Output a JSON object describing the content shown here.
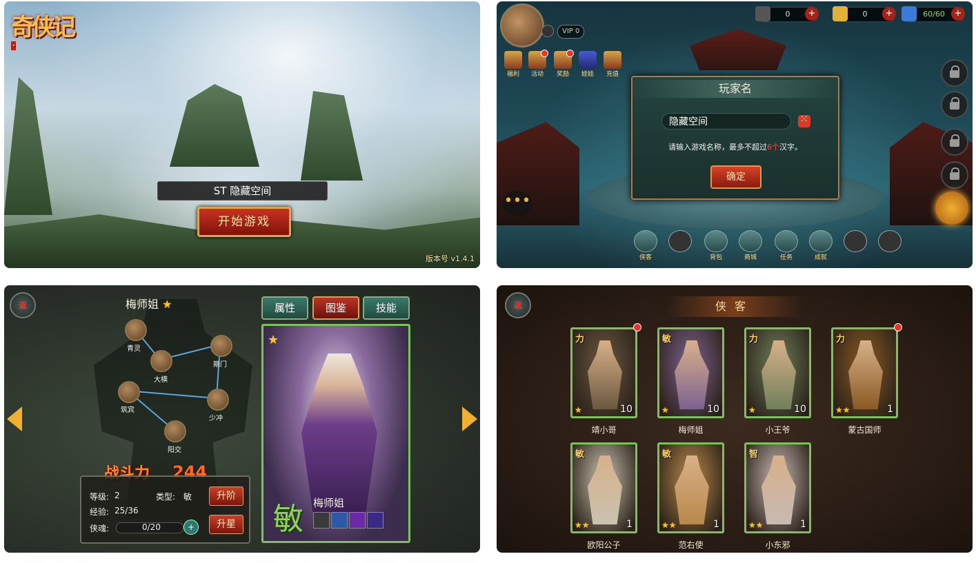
{
  "panel1": {
    "logo_text": "奇侠记",
    "server_label": "ST 隐藏空间",
    "start_button": "开始游戏",
    "version": "版本号 v1.4.1"
  },
  "panel2": {
    "resources": [
      {
        "icon": "coin-icon",
        "value": "0"
      },
      {
        "icon": "gold-ingot-icon",
        "value": "0"
      },
      {
        "icon": "stamina-icon",
        "value": "60/60"
      }
    ],
    "vip_label": "VIP 0",
    "top_icons": [
      {
        "label": "福利",
        "dot": false
      },
      {
        "label": "活动",
        "dot": true
      },
      {
        "label": "奖励",
        "dot": true
      },
      {
        "label": "娃娃",
        "dot": false
      },
      {
        "label": "充值",
        "dot": false
      }
    ],
    "dialog": {
      "title": "玩家名",
      "name_value": "隐藏空间",
      "hint_pre": "请输入游戏名称，最多不超过",
      "hint_num": "6个",
      "hint_post": "汉字。",
      "confirm": "确定"
    },
    "bottom_icons": [
      "侠客",
      "",
      "背包",
      "商城",
      "任务",
      "成就",
      ""
    ]
  },
  "panel3": {
    "back_label": "返",
    "hero_name": "梅师姐",
    "tabs": [
      "属性",
      "图鉴",
      "技能"
    ],
    "meridians": [
      {
        "label": "青灵"
      },
      {
        "label": "大横"
      },
      {
        "label": "期门"
      },
      {
        "label": "筑宾"
      },
      {
        "label": "少冲"
      },
      {
        "label": "阳交"
      }
    ],
    "power_label": "战斗力",
    "power_value": "244",
    "level_label": "等级:",
    "level_value": "2",
    "type_label": "类型:",
    "type_value": "敏",
    "exp_label": "经验:",
    "exp_value": "25/36",
    "soul_label": "侠魂:",
    "soul_value": "0/20",
    "upgrade_button": "升阶",
    "star_button": "升星",
    "card_type": "敏",
    "card_name": "梅师姐"
  },
  "panel4": {
    "back_label": "返",
    "title": "侠客",
    "heroes": [
      {
        "name": "靖小哥",
        "attr": "力",
        "level": "10",
        "stars": 1,
        "dot": true,
        "color": "#6b5840"
      },
      {
        "name": "梅师姐",
        "attr": "敏",
        "level": "10",
        "stars": 1,
        "dot": false,
        "color": "#7d6290"
      },
      {
        "name": "小王爷",
        "attr": "力",
        "level": "10",
        "stars": 1,
        "dot": false,
        "color": "#6f7f5a"
      },
      {
        "name": "蒙古国师",
        "attr": "力",
        "level": "1",
        "stars": 2,
        "dot": true,
        "color": "#8a5a24"
      },
      {
        "name": "欧阳公子",
        "attr": "敏",
        "level": "1",
        "stars": 2,
        "dot": false,
        "color": "#c9c2b0"
      },
      {
        "name": "范右使",
        "attr": "敏",
        "level": "1",
        "stars": 2,
        "dot": false,
        "color": "#b8894a"
      },
      {
        "name": "小东邪",
        "attr": "智",
        "level": "1",
        "stars": 2,
        "dot": false,
        "color": "#c7b9b4"
      }
    ]
  }
}
